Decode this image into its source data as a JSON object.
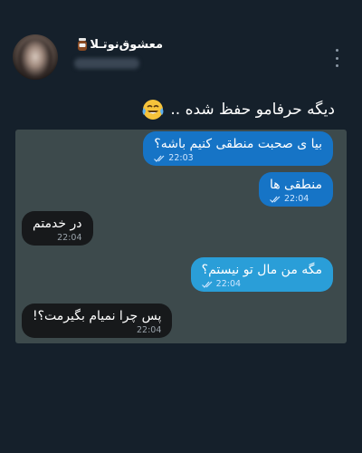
{
  "post": {
    "display_name": "معشوق‌نوتـلا",
    "name_icon": "jar-icon",
    "handle_blurred": true,
    "caption": "دیگه حرفامو حفظ شده ..",
    "caption_emoji": "face-with-tears-of-joy-icon"
  },
  "chat": {
    "messages": [
      {
        "direction": "out",
        "text": "بیا ی صحبت منطقی کنیم باشه؟",
        "time": "22:03",
        "read_icon": "double-check-icon"
      },
      {
        "direction": "out",
        "text": "منطقی ها",
        "time": "22:04",
        "read_icon": "double-check-icon"
      },
      {
        "direction": "in",
        "text": "در خدمتم",
        "time": "22:04"
      },
      {
        "direction": "out",
        "text": "مگه من مال تو نیستم؟",
        "time": "22:04",
        "read_icon": "double-check-icon"
      },
      {
        "direction": "in",
        "text": "پس چرا نمیام بگیرمت؟!",
        "time": "22:04"
      }
    ]
  },
  "colors": {
    "background": "#15202b",
    "chat_background": "#3d4a4c",
    "outgoing_bubble": "#1674c6",
    "outgoing_bubble_light": "#2a9ed8",
    "incoming_bubble": "#17191b"
  }
}
